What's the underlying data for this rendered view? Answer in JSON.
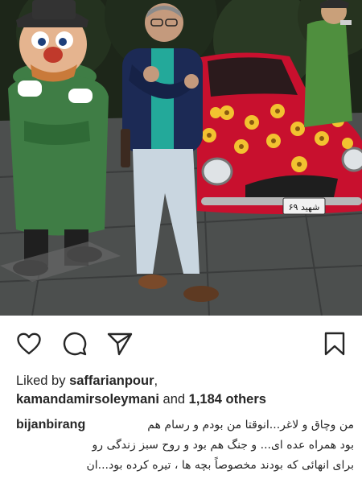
{
  "post": {
    "photo_alt": "photo",
    "plate_text": "شهید ۶۹",
    "liked_by_prefix": "Liked by",
    "liker_1": "saffarianpour",
    "liker_1_suffix": ",",
    "liker_2": "kamandamirsoleymani",
    "and_word": "and",
    "others": "1,184 others",
    "caption_user": "bijanbirang",
    "caption_lines": [
      "من وچاق و لاغر...انوقتا من بودم و رسام هم",
      "بود همراه عده ای... و جنگ هم بود و روح سبز زندگی رو",
      "برای انهائی که بودند مخصوصاً بچه ها ، تیره کرده بود...ان"
    ]
  },
  "icons": {
    "like": "heart-icon",
    "comment": "comment-icon",
    "share": "paper-plane-icon",
    "save": "bookmark-icon"
  },
  "colors": {
    "car": "#c8102e",
    "flower": "#f2c230",
    "coat_green": "#3f7d45",
    "text": "#262626"
  }
}
